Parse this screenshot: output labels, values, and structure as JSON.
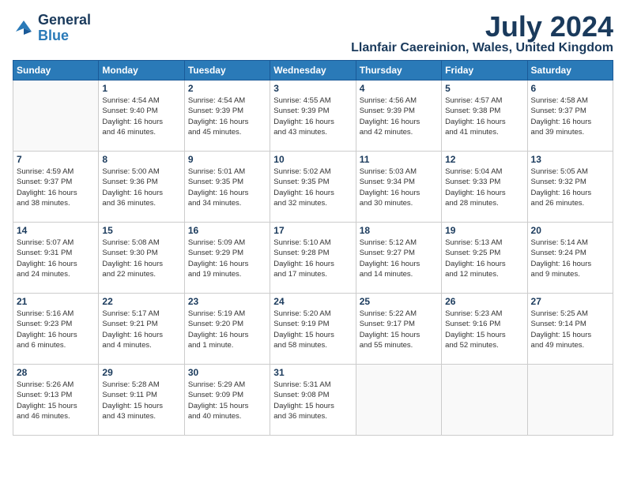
{
  "header": {
    "logo_line1": "General",
    "logo_line2": "Blue",
    "month_year": "July 2024",
    "location": "Llanfair Caereinion, Wales, United Kingdom"
  },
  "columns": [
    "Sunday",
    "Monday",
    "Tuesday",
    "Wednesday",
    "Thursday",
    "Friday",
    "Saturday"
  ],
  "weeks": [
    [
      {
        "num": "",
        "detail": ""
      },
      {
        "num": "1",
        "detail": "Sunrise: 4:54 AM\nSunset: 9:40 PM\nDaylight: 16 hours\nand 46 minutes."
      },
      {
        "num": "2",
        "detail": "Sunrise: 4:54 AM\nSunset: 9:39 PM\nDaylight: 16 hours\nand 45 minutes."
      },
      {
        "num": "3",
        "detail": "Sunrise: 4:55 AM\nSunset: 9:39 PM\nDaylight: 16 hours\nand 43 minutes."
      },
      {
        "num": "4",
        "detail": "Sunrise: 4:56 AM\nSunset: 9:39 PM\nDaylight: 16 hours\nand 42 minutes."
      },
      {
        "num": "5",
        "detail": "Sunrise: 4:57 AM\nSunset: 9:38 PM\nDaylight: 16 hours\nand 41 minutes."
      },
      {
        "num": "6",
        "detail": "Sunrise: 4:58 AM\nSunset: 9:37 PM\nDaylight: 16 hours\nand 39 minutes."
      }
    ],
    [
      {
        "num": "7",
        "detail": "Sunrise: 4:59 AM\nSunset: 9:37 PM\nDaylight: 16 hours\nand 38 minutes."
      },
      {
        "num": "8",
        "detail": "Sunrise: 5:00 AM\nSunset: 9:36 PM\nDaylight: 16 hours\nand 36 minutes."
      },
      {
        "num": "9",
        "detail": "Sunrise: 5:01 AM\nSunset: 9:35 PM\nDaylight: 16 hours\nand 34 minutes."
      },
      {
        "num": "10",
        "detail": "Sunrise: 5:02 AM\nSunset: 9:35 PM\nDaylight: 16 hours\nand 32 minutes."
      },
      {
        "num": "11",
        "detail": "Sunrise: 5:03 AM\nSunset: 9:34 PM\nDaylight: 16 hours\nand 30 minutes."
      },
      {
        "num": "12",
        "detail": "Sunrise: 5:04 AM\nSunset: 9:33 PM\nDaylight: 16 hours\nand 28 minutes."
      },
      {
        "num": "13",
        "detail": "Sunrise: 5:05 AM\nSunset: 9:32 PM\nDaylight: 16 hours\nand 26 minutes."
      }
    ],
    [
      {
        "num": "14",
        "detail": "Sunrise: 5:07 AM\nSunset: 9:31 PM\nDaylight: 16 hours\nand 24 minutes."
      },
      {
        "num": "15",
        "detail": "Sunrise: 5:08 AM\nSunset: 9:30 PM\nDaylight: 16 hours\nand 22 minutes."
      },
      {
        "num": "16",
        "detail": "Sunrise: 5:09 AM\nSunset: 9:29 PM\nDaylight: 16 hours\nand 19 minutes."
      },
      {
        "num": "17",
        "detail": "Sunrise: 5:10 AM\nSunset: 9:28 PM\nDaylight: 16 hours\nand 17 minutes."
      },
      {
        "num": "18",
        "detail": "Sunrise: 5:12 AM\nSunset: 9:27 PM\nDaylight: 16 hours\nand 14 minutes."
      },
      {
        "num": "19",
        "detail": "Sunrise: 5:13 AM\nSunset: 9:25 PM\nDaylight: 16 hours\nand 12 minutes."
      },
      {
        "num": "20",
        "detail": "Sunrise: 5:14 AM\nSunset: 9:24 PM\nDaylight: 16 hours\nand 9 minutes."
      }
    ],
    [
      {
        "num": "21",
        "detail": "Sunrise: 5:16 AM\nSunset: 9:23 PM\nDaylight: 16 hours\nand 6 minutes."
      },
      {
        "num": "22",
        "detail": "Sunrise: 5:17 AM\nSunset: 9:21 PM\nDaylight: 16 hours\nand 4 minutes."
      },
      {
        "num": "23",
        "detail": "Sunrise: 5:19 AM\nSunset: 9:20 PM\nDaylight: 16 hours\nand 1 minute."
      },
      {
        "num": "24",
        "detail": "Sunrise: 5:20 AM\nSunset: 9:19 PM\nDaylight: 15 hours\nand 58 minutes."
      },
      {
        "num": "25",
        "detail": "Sunrise: 5:22 AM\nSunset: 9:17 PM\nDaylight: 15 hours\nand 55 minutes."
      },
      {
        "num": "26",
        "detail": "Sunrise: 5:23 AM\nSunset: 9:16 PM\nDaylight: 15 hours\nand 52 minutes."
      },
      {
        "num": "27",
        "detail": "Sunrise: 5:25 AM\nSunset: 9:14 PM\nDaylight: 15 hours\nand 49 minutes."
      }
    ],
    [
      {
        "num": "28",
        "detail": "Sunrise: 5:26 AM\nSunset: 9:13 PM\nDaylight: 15 hours\nand 46 minutes."
      },
      {
        "num": "29",
        "detail": "Sunrise: 5:28 AM\nSunset: 9:11 PM\nDaylight: 15 hours\nand 43 minutes."
      },
      {
        "num": "30",
        "detail": "Sunrise: 5:29 AM\nSunset: 9:09 PM\nDaylight: 15 hours\nand 40 minutes."
      },
      {
        "num": "31",
        "detail": "Sunrise: 5:31 AM\nSunset: 9:08 PM\nDaylight: 15 hours\nand 36 minutes."
      },
      {
        "num": "",
        "detail": ""
      },
      {
        "num": "",
        "detail": ""
      },
      {
        "num": "",
        "detail": ""
      }
    ]
  ]
}
